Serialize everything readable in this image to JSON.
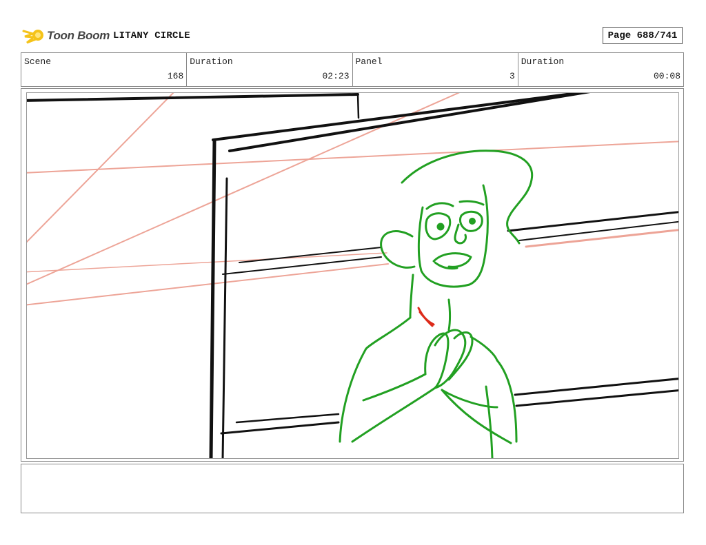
{
  "header": {
    "logo_text": "Toon Boom",
    "project_title": "LITANY CIRCLE",
    "page_label": "Page 688/741"
  },
  "info": {
    "scene_label": "Scene",
    "scene_value": "168",
    "duration_label": "Duration",
    "duration_value": "02:23",
    "panel_label": "Panel",
    "panel_value": "3",
    "panel_duration_label": "Duration",
    "panel_duration_value": "00:08"
  },
  "notes": {
    "text": ""
  },
  "colors": {
    "ink": "#111111",
    "character": "#22a022",
    "guide": "#eda497",
    "accent": "#dd2b1b",
    "logo": "#f5c319"
  }
}
